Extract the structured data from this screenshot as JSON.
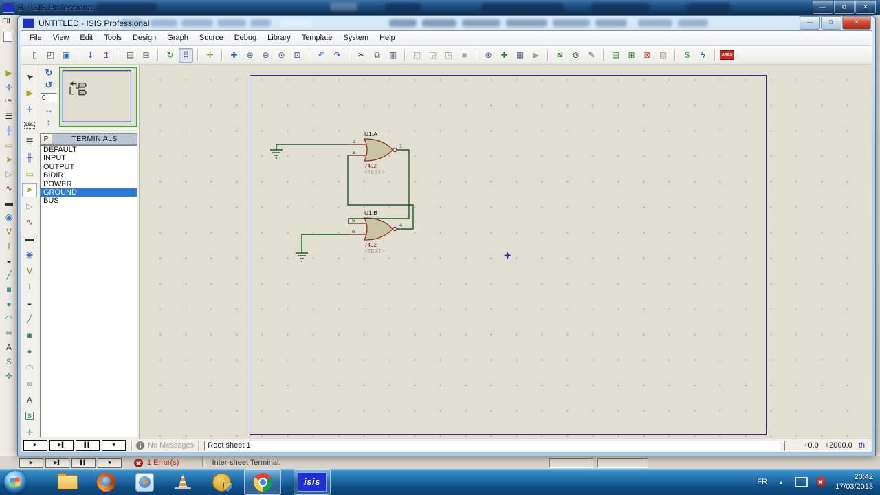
{
  "bg_window": {
    "title": "B - ISIS Professional",
    "menu_fragment": "Fil",
    "status": {
      "errors": "1 Error(s)",
      "message": "Inter-sheet Terminal."
    }
  },
  "win": {
    "title": "UNTITLED - ISIS Professional"
  },
  "win_controls": {
    "minimize": "—",
    "restore": "⧉",
    "close": "✕"
  },
  "menu": [
    "File",
    "View",
    "Edit",
    "Tools",
    "Design",
    "Graph",
    "Source",
    "Debug",
    "Library",
    "Template",
    "System",
    "Help"
  ],
  "toolbar": [
    {
      "name": "new-document",
      "glyph": "▯"
    },
    {
      "name": "open-document",
      "glyph": "◰"
    },
    {
      "name": "save-document",
      "glyph": "▣"
    },
    {
      "name": "import-section",
      "glyph": "↧"
    },
    {
      "name": "export-section",
      "glyph": "↥"
    },
    {
      "name": "print",
      "glyph": "▤"
    },
    {
      "name": "mark-output-area",
      "glyph": "⊞"
    },
    {
      "name": "redraw",
      "glyph": "↻"
    },
    {
      "name": "toggle-grid",
      "glyph": "⠿"
    },
    {
      "name": "false-origin",
      "glyph": "✛"
    },
    {
      "name": "pan",
      "glyph": "✚"
    },
    {
      "name": "zoom-in",
      "glyph": "⊕"
    },
    {
      "name": "zoom-out",
      "glyph": "⊖"
    },
    {
      "name": "zoom-all",
      "glyph": "⊙"
    },
    {
      "name": "zoom-area",
      "glyph": "⊡"
    },
    {
      "name": "undo",
      "glyph": "↶"
    },
    {
      "name": "redo",
      "glyph": "↷"
    },
    {
      "name": "cut",
      "glyph": "✂"
    },
    {
      "name": "copy",
      "glyph": "⧉"
    },
    {
      "name": "paste",
      "glyph": "▥"
    },
    {
      "name": "block-copy",
      "glyph": "◱"
    },
    {
      "name": "block-move",
      "glyph": "◲"
    },
    {
      "name": "block-rotate",
      "glyph": "◳"
    },
    {
      "name": "block-delete",
      "glyph": "■"
    },
    {
      "name": "pick-parts",
      "glyph": "⊛"
    },
    {
      "name": "make-device",
      "glyph": "✚"
    },
    {
      "name": "packaging-tool",
      "glyph": "▦"
    },
    {
      "name": "decompose",
      "glyph": "▶"
    },
    {
      "name": "wire-autorouter",
      "glyph": "≋"
    },
    {
      "name": "search-tag",
      "glyph": "⊚"
    },
    {
      "name": "property-assignment",
      "glyph": "✎"
    },
    {
      "name": "design-explorer",
      "glyph": "▤"
    },
    {
      "name": "new-sheet",
      "glyph": "⊞"
    },
    {
      "name": "remove-sheet",
      "glyph": "⊠"
    },
    {
      "name": "goto-sheet",
      "glyph": "▧"
    },
    {
      "name": "bill-of-materials",
      "glyph": "$"
    },
    {
      "name": "electrical-rule-check",
      "glyph": "ϟ"
    },
    {
      "name": "ares-netlist",
      "glyph": "ARES"
    }
  ],
  "mode_toolbar": [
    {
      "name": "selection-pointer",
      "glyph": "➤"
    },
    {
      "name": "component-mode",
      "glyph": "▶"
    },
    {
      "name": "junction-dot-mode",
      "glyph": "✛"
    },
    {
      "name": "wire-label-mode",
      "glyph": "LBL"
    },
    {
      "name": "text-script-mode",
      "glyph": "☰"
    },
    {
      "name": "buses-mode",
      "glyph": "╫"
    },
    {
      "name": "subcircuit-mode",
      "glyph": "▭"
    },
    {
      "name": "terminals-mode",
      "glyph": "➤"
    },
    {
      "name": "device-pins-mode",
      "glyph": "▷"
    },
    {
      "name": "graph-mode",
      "glyph": "∿"
    },
    {
      "name": "tape-recorder-mode",
      "glyph": "▬"
    },
    {
      "name": "generator-mode",
      "glyph": "◉"
    },
    {
      "name": "voltage-probe-mode",
      "glyph": "V"
    },
    {
      "name": "current-probe-mode",
      "glyph": "I"
    },
    {
      "name": "virtual-instruments-mode",
      "glyph": "◒"
    },
    {
      "name": "2d-line-mode",
      "glyph": "╱"
    },
    {
      "name": "2d-box-mode",
      "glyph": "■"
    },
    {
      "name": "2d-circle-mode",
      "glyph": "●"
    },
    {
      "name": "2d-arc-mode",
      "glyph": "◠"
    },
    {
      "name": "2d-path-mode",
      "glyph": "∞"
    },
    {
      "name": "2d-text-mode",
      "glyph": "A"
    },
    {
      "name": "2d-symbol-mode",
      "glyph": "S"
    },
    {
      "name": "2d-marker-mode",
      "glyph": "✛"
    }
  ],
  "rotation": {
    "cw_glyph": "↻",
    "ccw_glyph": "↺",
    "angle": "0",
    "mirror_h": "↔",
    "mirror_v": "↕"
  },
  "selector": {
    "pick_button": "P",
    "title": "TERMIN ALS",
    "items": [
      "DEFAULT",
      "INPUT",
      "OUTPUT",
      "BIDIR",
      "POWER",
      "GROUND",
      "BUS"
    ]
  },
  "sim_controls": [
    {
      "name": "play-button",
      "glyph": "▶"
    },
    {
      "name": "step-button",
      "glyph": "▶▌"
    },
    {
      "name": "pause-button",
      "glyph": "▌▌"
    },
    {
      "name": "stop-button",
      "glyph": "■"
    }
  ],
  "status": {
    "no_messages": "No Messages",
    "sheet_name": "Root sheet 1",
    "coord_x": "+0.0",
    "coord_y": "+2000.0",
    "coord_units": "th"
  },
  "schematic": {
    "gates": [
      {
        "ref": "U1:A",
        "device": "7402",
        "placeholder": "<TEXT>",
        "pin_in1": "2",
        "pin_in2": "3",
        "pin_out": "1"
      },
      {
        "ref": "U1:B",
        "device": "7402",
        "placeholder": "<TEXT>",
        "pin_in1": "5",
        "pin_in2": "6",
        "pin_out": "4"
      }
    ]
  },
  "taskbar": {
    "isis_label": "isis",
    "tray": {
      "language": "FR",
      "expand_glyph": "▲",
      "time": "20:42",
      "date": "17/03/2013"
    }
  }
}
